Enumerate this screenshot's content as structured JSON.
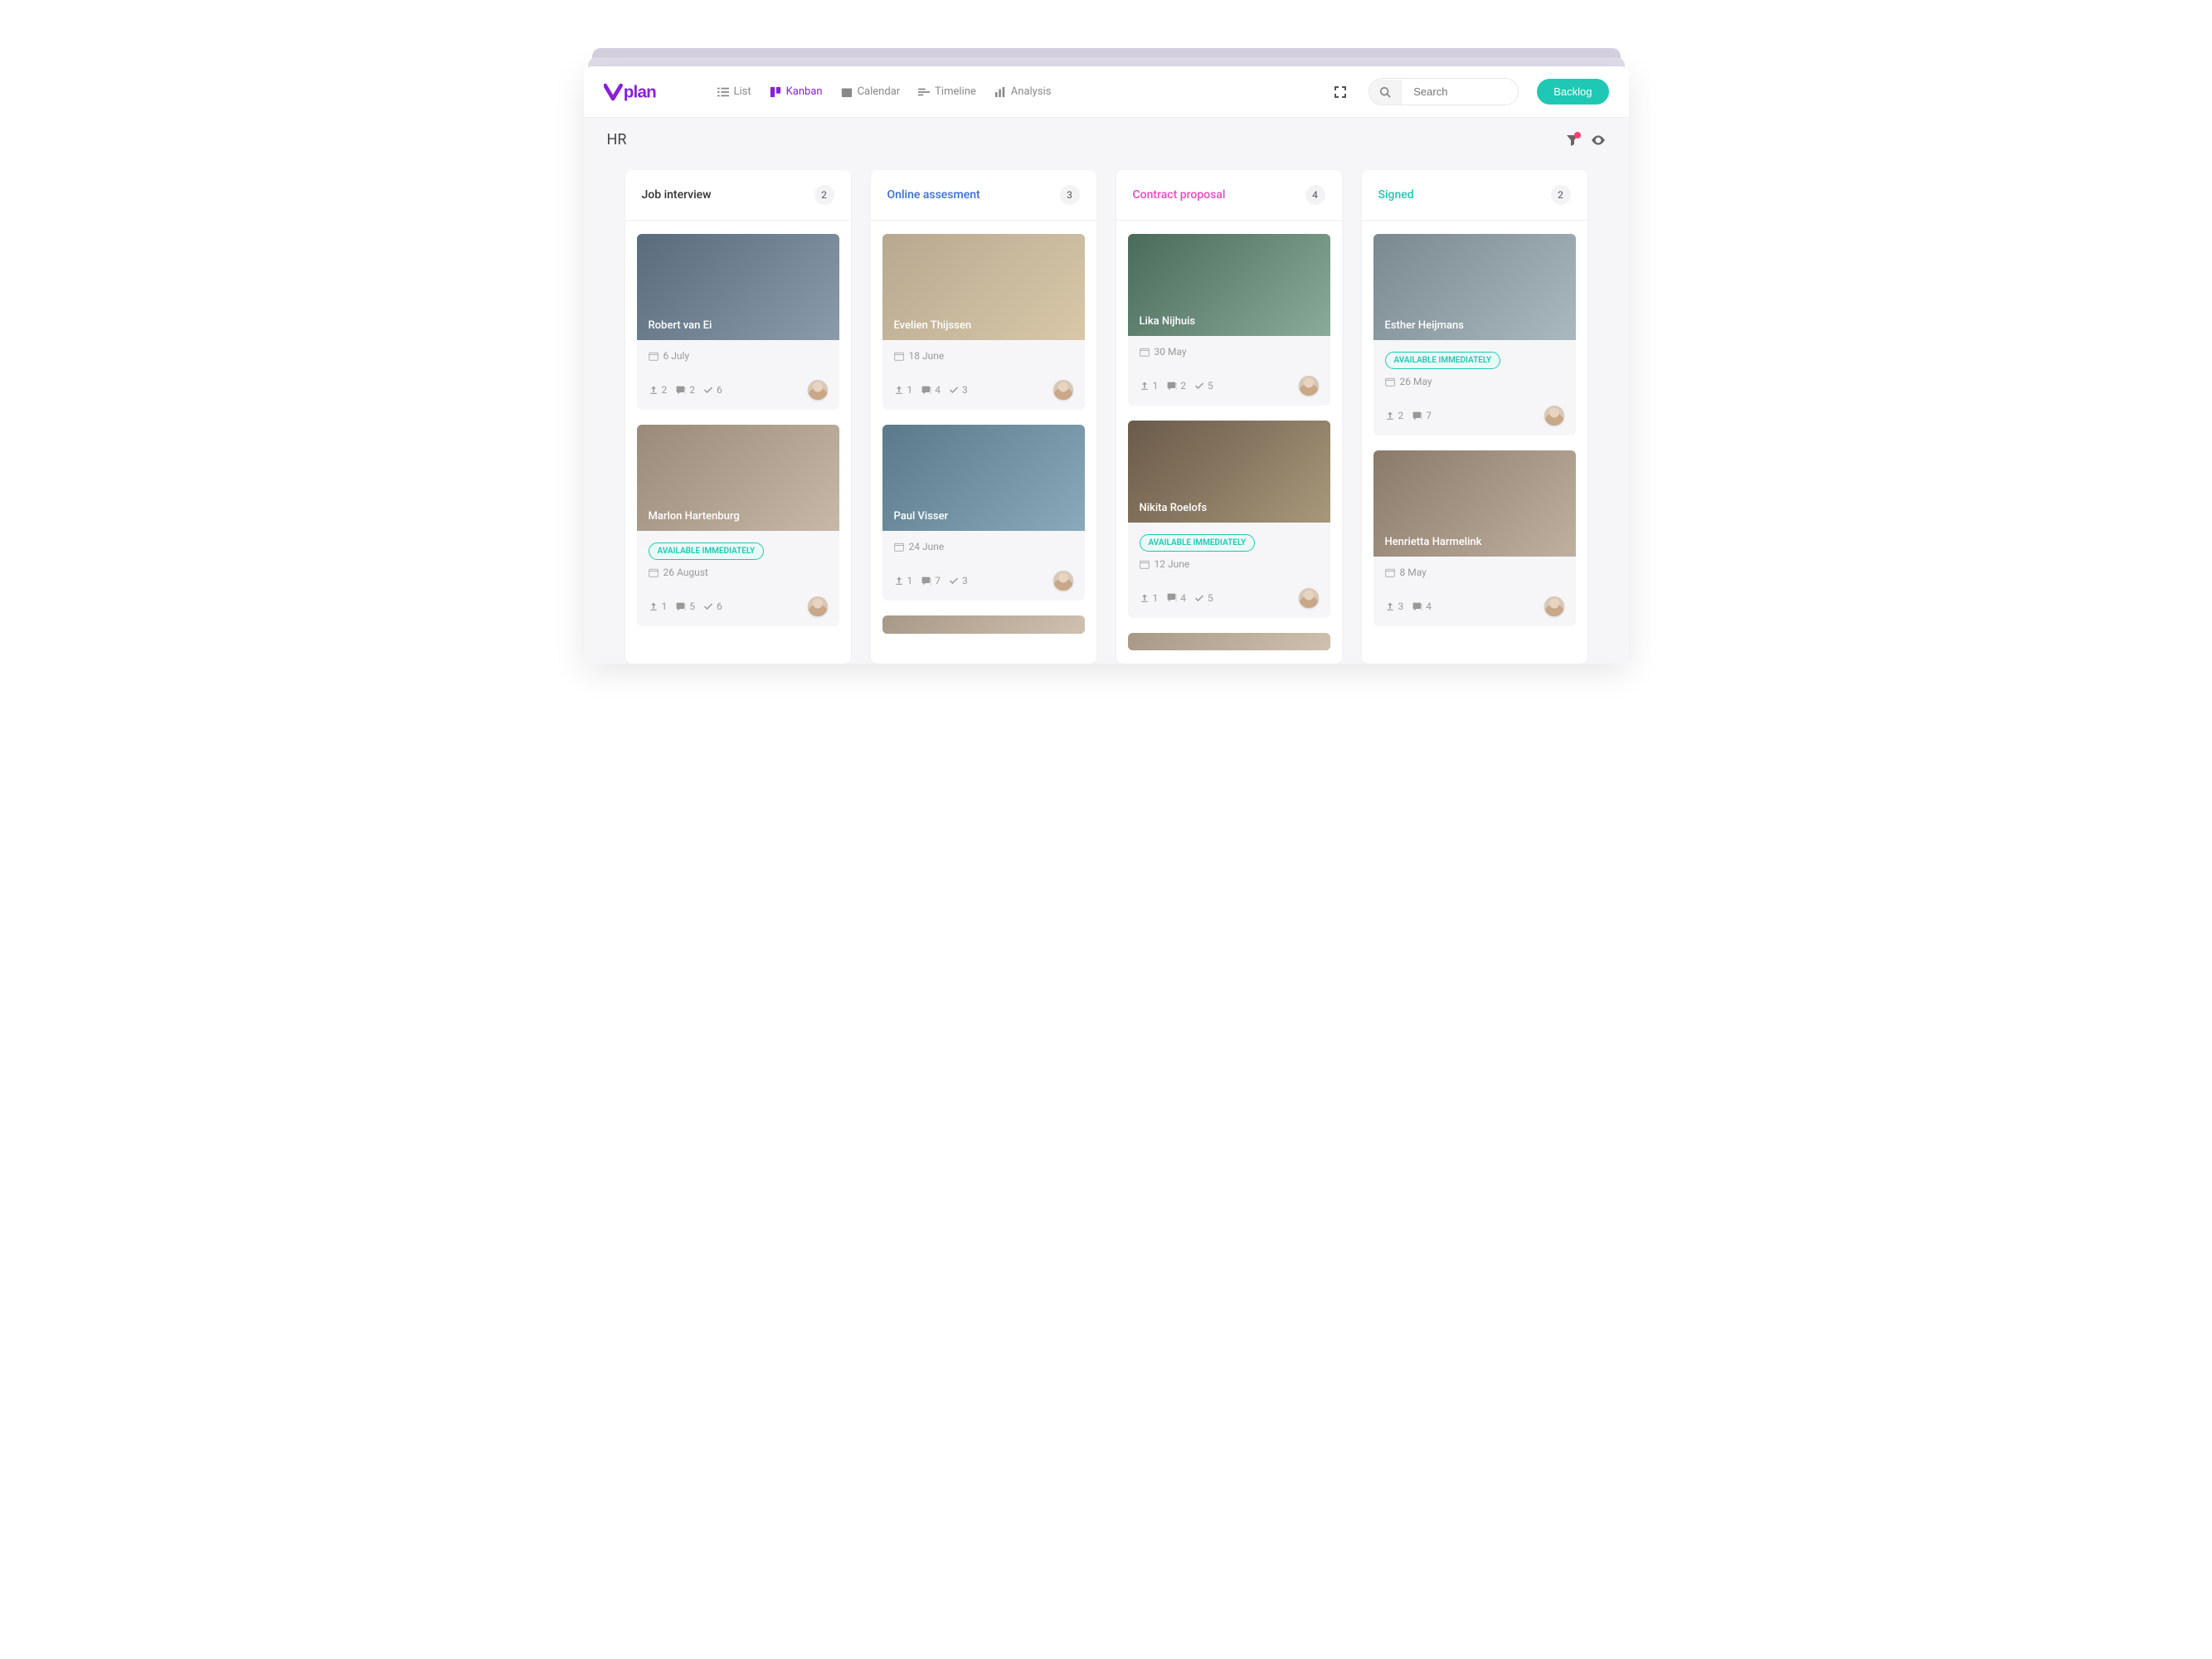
{
  "brand": "vplan",
  "views": {
    "list": "List",
    "kanban": "Kanban",
    "calendar": "Calendar",
    "timeline": "Timeline",
    "analysis": "Analysis",
    "active": "kanban"
  },
  "search": {
    "placeholder": "Search"
  },
  "backlog_label": "Backlog",
  "page_title": "HR",
  "tag_available": "AVAILABLE IMMEDIATELY",
  "columns": [
    {
      "id": "job-interview",
      "title": "Job interview",
      "title_color": "#333333",
      "count": 2,
      "cards": [
        {
          "name": "Robert van Ei",
          "date": "6 July",
          "uploads": 2,
          "comments": 2,
          "checks": 6,
          "tag": null,
          "img": "a"
        },
        {
          "name": "Marlon Hartenburg",
          "date": "26 August",
          "uploads": 1,
          "comments": 5,
          "checks": 6,
          "tag": "AVAILABLE IMMEDIATELY",
          "img": "e"
        }
      ]
    },
    {
      "id": "online-assessment",
      "title": "Online assesment",
      "title_color": "#3b6fd6",
      "count": 3,
      "cards": [
        {
          "name": "Evelien Thijssen",
          "date": "18 June",
          "uploads": 1,
          "comments": 4,
          "checks": 3,
          "tag": null,
          "img": "b"
        },
        {
          "name": "Paul Visser",
          "date": "24 June",
          "uploads": 1,
          "comments": 7,
          "checks": 3,
          "tag": null,
          "img": "f"
        }
      ],
      "has_more": true
    },
    {
      "id": "contract-proposal",
      "title": "Contract proposal",
      "title_color": "#e24cc0",
      "count": 4,
      "cards": [
        {
          "name": "Lika Nijhuis",
          "date": "30 May",
          "uploads": 1,
          "comments": 2,
          "checks": 5,
          "tag": null,
          "img": "c"
        },
        {
          "name": "Nikita Roelofs",
          "date": "12 June",
          "uploads": 1,
          "comments": 4,
          "checks": 5,
          "tag": "AVAILABLE IMMEDIATELY",
          "img": "g"
        }
      ],
      "has_more": true
    },
    {
      "id": "signed",
      "title": "Signed",
      "title_color": "#1fc8b4",
      "count": 2,
      "cards": [
        {
          "name": "Esther Heijmans",
          "date": "26 May",
          "uploads": 2,
          "comments": 7,
          "checks": null,
          "tag": "AVAILABLE IMMEDIATELY",
          "img": "d"
        },
        {
          "name": "Henrietta Harmelink",
          "date": "8 May",
          "uploads": 3,
          "comments": 4,
          "checks": null,
          "tag": null,
          "img": "h"
        }
      ]
    }
  ]
}
